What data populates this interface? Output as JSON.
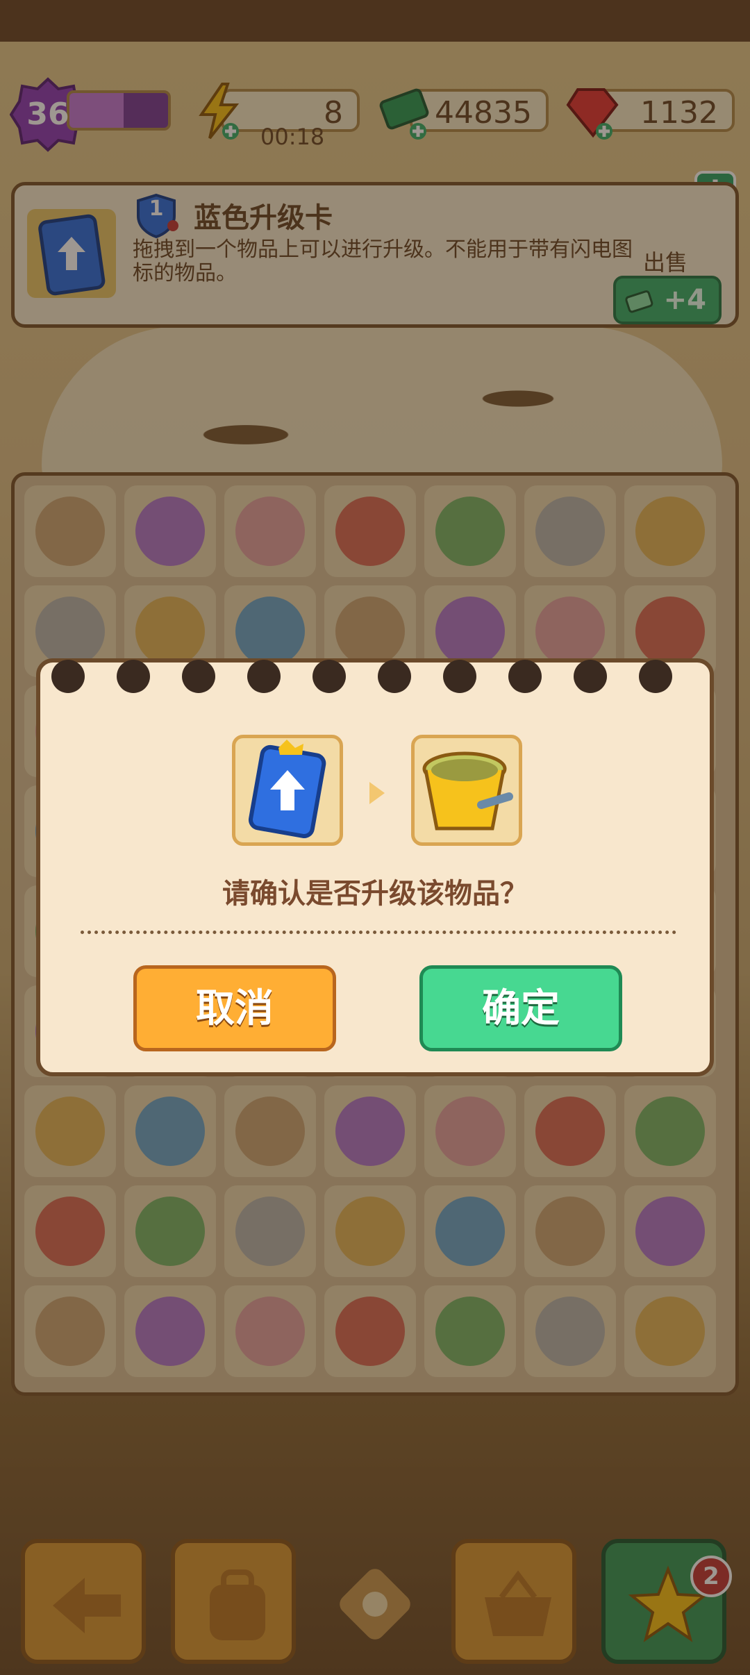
{
  "hud": {
    "level": "36",
    "xp_progress": 0.55,
    "energy": "8",
    "energy_timer": "00:18",
    "cash": "44835",
    "gems": "1132"
  },
  "item_info": {
    "title": "蓝色升级卡",
    "tier": "1",
    "description": "拖拽到一个物品上可以进行升级。不能用于带有闪电图标的物品。",
    "sell_label": "出售",
    "sell_value": "+4",
    "help_icon": "i"
  },
  "dialog": {
    "question": "请确认是否升级该物品？",
    "cancel_label": "取消",
    "confirm_label": "确定",
    "source_item_icon": "blue-upgrade-card-icon",
    "target_item_icon": "yellow-bucket-icon"
  },
  "bottom_bar": {
    "star_badge": "2",
    "buttons": [
      "back-icon",
      "backpack-icon",
      "puzzle-icon",
      "basket-icon",
      "star-icon"
    ]
  },
  "colors": {
    "cancel_button": "#ffae34",
    "confirm_button": "#47d891",
    "modal_bg": "#f8e7cd",
    "xp_bar": "#7b3f99",
    "sell_button": "#3bb06e"
  }
}
